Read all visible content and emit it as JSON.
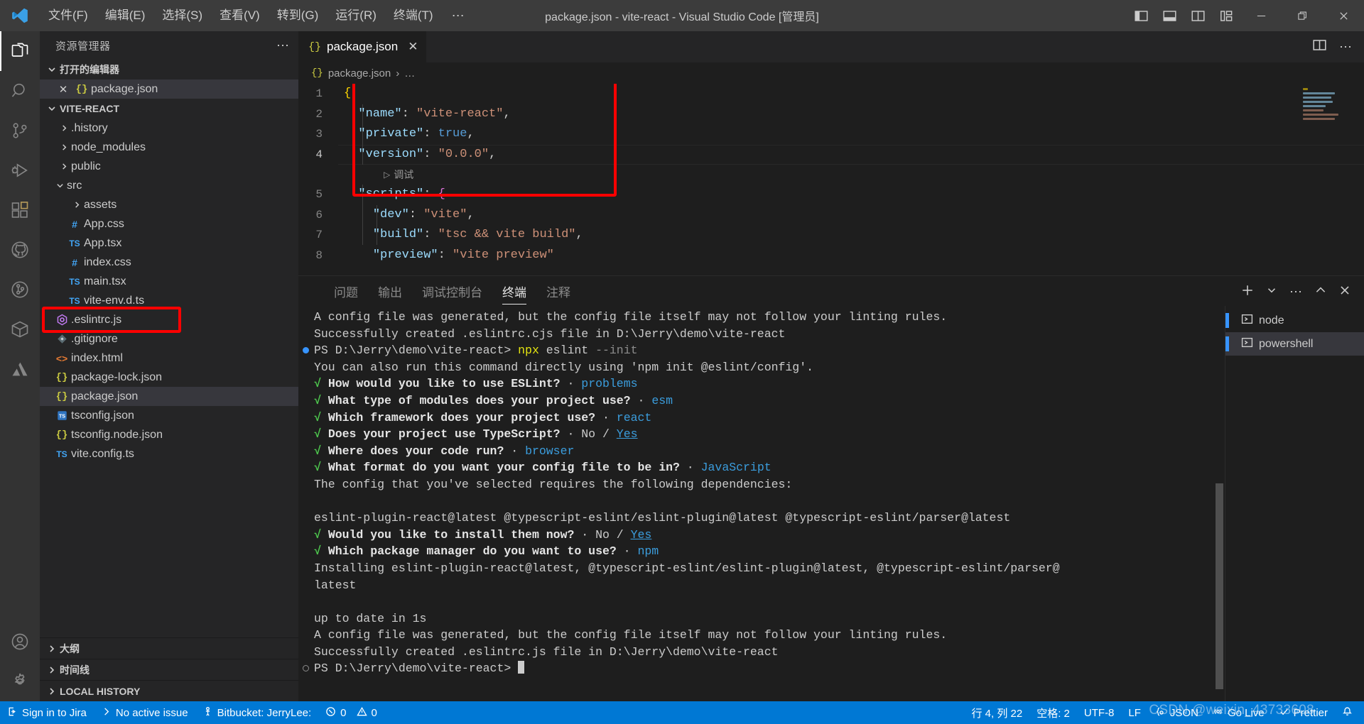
{
  "titlebar": {
    "menu": [
      "文件(F)",
      "编辑(E)",
      "选择(S)",
      "查看(V)",
      "转到(G)",
      "运行(R)",
      "终端(T)"
    ],
    "menu_overflow": "⋯",
    "title": "package.json - vite-react - Visual Studio Code [管理员]",
    "layout_icons": [
      "primary-sidebar-icon",
      "panel-icon",
      "secondary-sidebar-icon",
      "customize-layout-icon"
    ],
    "window_controls": [
      "minimize",
      "restore",
      "close"
    ]
  },
  "activitybar": {
    "items": [
      {
        "name": "explorer-icon",
        "active": true
      },
      {
        "name": "search-icon",
        "active": false
      },
      {
        "name": "source-control-icon",
        "active": false
      },
      {
        "name": "run-and-debug-icon",
        "active": false
      },
      {
        "name": "extensions-icon",
        "active": false
      },
      {
        "name": "github-icon",
        "active": false
      },
      {
        "name": "git-graph-icon",
        "active": false
      },
      {
        "name": "package-icon",
        "active": false
      },
      {
        "name": "atlassian-icon",
        "active": false
      }
    ],
    "bottom": [
      {
        "name": "accounts-icon"
      },
      {
        "name": "settings-gear-icon"
      }
    ]
  },
  "sidebar": {
    "header": "资源管理器",
    "header_dots": "⋯",
    "open_editors": {
      "label": "打开的编辑器",
      "items": [
        {
          "name": "package.json",
          "icon": "json-icon",
          "selected": true,
          "close": "✕"
        }
      ]
    },
    "project": {
      "label": "VITE-REACT",
      "items": [
        {
          "label": ".history",
          "icon": "folder",
          "indent": 1,
          "expanded": false
        },
        {
          "label": "node_modules",
          "icon": "folder",
          "indent": 1,
          "expanded": false
        },
        {
          "label": "public",
          "icon": "folder",
          "indent": 1,
          "expanded": false
        },
        {
          "label": "src",
          "icon": "folder",
          "indent": 1,
          "expanded": true
        },
        {
          "label": "assets",
          "icon": "folder",
          "indent": 2,
          "expanded": false
        },
        {
          "label": "App.css",
          "icon": "css-icon",
          "indent": 2
        },
        {
          "label": "App.tsx",
          "icon": "ts-icon",
          "indent": 2
        },
        {
          "label": "index.css",
          "icon": "css-icon",
          "indent": 2
        },
        {
          "label": "main.tsx",
          "icon": "ts-icon",
          "indent": 2
        },
        {
          "label": "vite-env.d.ts",
          "icon": "ts-icon",
          "indent": 2
        },
        {
          "label": ".eslintrc.js",
          "icon": "eslint-icon",
          "indent": 1,
          "highlighted": true
        },
        {
          "label": ".gitignore",
          "icon": "git-icon",
          "indent": 1
        },
        {
          "label": "index.html",
          "icon": "html-icon",
          "indent": 1
        },
        {
          "label": "package-lock.json",
          "icon": "json-icon",
          "indent": 1
        },
        {
          "label": "package.json",
          "icon": "json-icon",
          "indent": 1,
          "selected": true
        },
        {
          "label": "tsconfig.json",
          "icon": "tsconfig-icon",
          "indent": 1
        },
        {
          "label": "tsconfig.node.json",
          "icon": "json-icon",
          "indent": 1
        },
        {
          "label": "vite.config.ts",
          "icon": "ts-icon",
          "indent": 1
        }
      ]
    },
    "collapsed_sections": [
      "大纲",
      "时间线",
      "LOCAL HISTORY"
    ]
  },
  "editor": {
    "tab": {
      "label": "package.json",
      "icon": "json-icon",
      "close": "✕"
    },
    "tab_actions": [
      "split-editor-icon",
      "more-actions-dots"
    ],
    "breadcrumb": {
      "icon": "json-icon",
      "file": "package.json",
      "sep": "›",
      "rest": "…"
    },
    "lines": [
      {
        "no": "1",
        "tokens": [
          {
            "t": "{",
            "c": "k-brace"
          }
        ]
      },
      {
        "no": "2",
        "tokens": [
          {
            "t": "  ",
            "c": "k-punc"
          },
          {
            "t": "\"name\"",
            "c": "k-key"
          },
          {
            "t": ": ",
            "c": "k-punc"
          },
          {
            "t": "\"vite-react\"",
            "c": "k-str"
          },
          {
            "t": ",",
            "c": "k-punc"
          }
        ]
      },
      {
        "no": "3",
        "tokens": [
          {
            "t": "  ",
            "c": "k-punc"
          },
          {
            "t": "\"private\"",
            "c": "k-key"
          },
          {
            "t": ": ",
            "c": "k-punc"
          },
          {
            "t": "true",
            "c": "k-bool"
          },
          {
            "t": ",",
            "c": "k-punc"
          }
        ]
      },
      {
        "no": "4",
        "tokens": [
          {
            "t": "  ",
            "c": "k-punc"
          },
          {
            "t": "\"version\"",
            "c": "k-key"
          },
          {
            "t": ": ",
            "c": "k-punc"
          },
          {
            "t": "\"0.0.0\"",
            "c": "k-str"
          },
          {
            "t": ",",
            "c": "k-punc"
          }
        ]
      },
      {
        "no": "5",
        "tokens": [
          {
            "t": "  ",
            "c": "k-punc"
          },
          {
            "t": "\"scripts\"",
            "c": "k-key"
          },
          {
            "t": ": ",
            "c": "k-punc"
          },
          {
            "t": "{",
            "c": "k-brace2"
          }
        ]
      },
      {
        "no": "6",
        "tokens": [
          {
            "t": "    ",
            "c": "k-punc"
          },
          {
            "t": "\"dev\"",
            "c": "k-key"
          },
          {
            "t": ": ",
            "c": "k-punc"
          },
          {
            "t": "\"vite\"",
            "c": "k-str"
          },
          {
            "t": ",",
            "c": "k-punc"
          }
        ]
      },
      {
        "no": "7",
        "tokens": [
          {
            "t": "    ",
            "c": "k-punc"
          },
          {
            "t": "\"build\"",
            "c": "k-key"
          },
          {
            "t": ": ",
            "c": "k-punc"
          },
          {
            "t": "\"tsc && vite build\"",
            "c": "k-str"
          },
          {
            "t": ",",
            "c": "k-punc"
          }
        ]
      },
      {
        "no": "8",
        "tokens": [
          {
            "t": "    ",
            "c": "k-punc"
          },
          {
            "t": "\"preview\"",
            "c": "k-key"
          },
          {
            "t": ": ",
            "c": "k-punc"
          },
          {
            "t": "\"vite preview\"",
            "c": "k-str"
          }
        ]
      }
    ],
    "codelens": {
      "icon": "▷",
      "label": "调试"
    }
  },
  "panel": {
    "tabs": [
      {
        "label": "问题",
        "active": false
      },
      {
        "label": "输出",
        "active": false
      },
      {
        "label": "调试控制台",
        "active": false
      },
      {
        "label": "终端",
        "active": true
      },
      {
        "label": "注释",
        "active": false
      }
    ],
    "actions": [
      "new-terminal-plus-icon",
      "terminal-dropdown-chevron-icon",
      "more-actions-dots",
      "maximize-panel-chevron-icon",
      "close-panel-icon"
    ],
    "terminal_list": [
      {
        "label": "node",
        "icon": "terminal-icon",
        "active": false
      },
      {
        "label": "powershell",
        "icon": "terminal-icon",
        "active": true
      }
    ],
    "terminal_lines": [
      [
        {
          "t": "A config file was generated, but the config file itself may not follow your linting rules.",
          "c": "t-white"
        }
      ],
      [
        {
          "t": "Successfully created .eslintrc.cjs file in D:\\Jerry\\demo\\vite-react",
          "c": "t-white"
        }
      ],
      [
        {
          "t": "PS D:\\Jerry\\demo\\vite-react> ",
          "c": "t-white"
        },
        {
          "t": "npx",
          "c": "t-yellow"
        },
        {
          "t": " eslint ",
          "c": "t-white"
        },
        {
          "t": "--init",
          "c": "t-grey"
        }
      ],
      [
        {
          "t": "You can also run this command directly using 'npm init @eslint/config'.",
          "c": "t-white"
        }
      ],
      [
        {
          "t": "√ ",
          "c": "t-check"
        },
        {
          "t": "How would you like to use ESLint?",
          "c": "t-bold"
        },
        {
          "t": " · ",
          "c": "t-white"
        },
        {
          "t": "problems",
          "c": "t-blue"
        }
      ],
      [
        {
          "t": "√ ",
          "c": "t-check"
        },
        {
          "t": "What type of modules does your project use?",
          "c": "t-bold"
        },
        {
          "t": " · ",
          "c": "t-white"
        },
        {
          "t": "esm",
          "c": "t-blue"
        }
      ],
      [
        {
          "t": "√ ",
          "c": "t-check"
        },
        {
          "t": "Which framework does your project use?",
          "c": "t-bold"
        },
        {
          "t": " · ",
          "c": "t-white"
        },
        {
          "t": "react",
          "c": "t-blue"
        }
      ],
      [
        {
          "t": "√ ",
          "c": "t-check"
        },
        {
          "t": "Does your project use TypeScript?",
          "c": "t-bold"
        },
        {
          "t": " · No / ",
          "c": "t-white"
        },
        {
          "t": "Yes",
          "c": "t-ul"
        }
      ],
      [
        {
          "t": "√ ",
          "c": "t-check"
        },
        {
          "t": "Where does your code run?",
          "c": "t-bold"
        },
        {
          "t": " · ",
          "c": "t-white"
        },
        {
          "t": "browser",
          "c": "t-blue"
        }
      ],
      [
        {
          "t": "√ ",
          "c": "t-check"
        },
        {
          "t": "What format do you want your config file to be in?",
          "c": "t-bold"
        },
        {
          "t": " · ",
          "c": "t-white"
        },
        {
          "t": "JavaScript",
          "c": "t-blue"
        }
      ],
      [
        {
          "t": "The config that you've selected requires the following dependencies:",
          "c": "t-white"
        }
      ],
      [
        {
          "t": "",
          "c": "t-white"
        }
      ],
      [
        {
          "t": "eslint-plugin-react@latest @typescript-eslint/eslint-plugin@latest @typescript-eslint/parser@latest",
          "c": "t-white"
        }
      ],
      [
        {
          "t": "√ ",
          "c": "t-check"
        },
        {
          "t": "Would you like to install them now?",
          "c": "t-bold"
        },
        {
          "t": " · No / ",
          "c": "t-white"
        },
        {
          "t": "Yes",
          "c": "t-ul"
        }
      ],
      [
        {
          "t": "√ ",
          "c": "t-check"
        },
        {
          "t": "Which package manager do you want to use?",
          "c": "t-bold"
        },
        {
          "t": " · ",
          "c": "t-white"
        },
        {
          "t": "npm",
          "c": "t-blue"
        }
      ],
      [
        {
          "t": "Installing eslint-plugin-react@latest, @typescript-eslint/eslint-plugin@latest, @typescript-eslint/parser@",
          "c": "t-white"
        }
      ],
      [
        {
          "t": "latest",
          "c": "t-white"
        }
      ],
      [
        {
          "t": "",
          "c": "t-white"
        }
      ],
      [
        {
          "t": "up to date in 1s",
          "c": "t-white"
        }
      ],
      [
        {
          "t": "A config file was generated, but the config file itself may not follow your linting rules.",
          "c": "t-white"
        }
      ],
      [
        {
          "t": "Successfully created .eslintrc.js file in D:\\Jerry\\demo\\vite-react",
          "c": "t-white"
        }
      ],
      [
        {
          "t": "PS D:\\Jerry\\demo\\vite-react> ",
          "c": "t-white"
        }
      ]
    ]
  },
  "statusbar": {
    "left": [
      {
        "label": "Sign in to Jira",
        "icon": "jira-signin-icon"
      },
      {
        "label": "No active issue",
        "icon": "chevron-right-icon"
      },
      {
        "label": "Bitbucket: JerryLee:",
        "icon": "bitbucket-person-icon"
      },
      {
        "label": "0",
        "icon": "error-icon",
        "label2": "0",
        "icon2": "warning-icon"
      }
    ],
    "right": [
      {
        "label": "行 4, 列 22",
        "name": "cursor-position"
      },
      {
        "label": "空格: 2",
        "name": "indentation"
      },
      {
        "label": "UTF-8",
        "name": "encoding"
      },
      {
        "label": "LF",
        "name": "eol"
      },
      {
        "label": "JSON",
        "name": "language-mode",
        "icon": "json-brace-icon"
      },
      {
        "label": "Go Live",
        "name": "go-live",
        "icon": "broadcast-icon"
      },
      {
        "label": "Prettier",
        "name": "prettier",
        "icon": "check-icon"
      },
      {
        "label": "",
        "name": "notifications",
        "icon": "bell-icon"
      }
    ]
  },
  "watermark": "CSDN @weixin_43733608",
  "colors": {
    "accent": "#0078d4",
    "annotation": "#ff0000",
    "titlebar_bg": "#3c3c3c",
    "sidebar_bg": "#252526",
    "editor_bg": "#1e1e1e"
  }
}
